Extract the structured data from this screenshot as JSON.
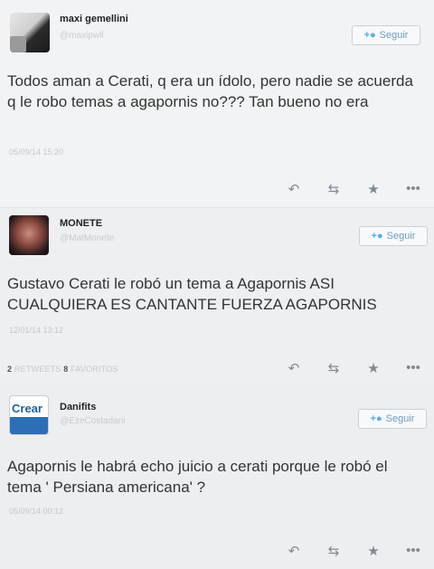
{
  "follow_label": "Seguir",
  "tweets": [
    {
      "name": "maxi gemellini",
      "handle": "@maxipwll",
      "text": "Todos aman a Cerati, q era un ídolo, pero nadie se acuerda q le robo temas a agapornis no??? Tan bueno no era",
      "timestamp": "05/09/14 15:20"
    },
    {
      "name": "MONETE",
      "handle": "@MatMonete",
      "text": "Gustavo Cerati le robó un tema a Agapornis ASI CUALQUIERA ES CANTANTE FUERZA AGAPORNIS",
      "timestamp": "12/01/14 13:12",
      "retweets_count": "2",
      "retweets_label": "RETWEETS",
      "favorites_count": "8",
      "favorites_label": "FAVORITOS"
    },
    {
      "name": "Danifits",
      "handle": "@EzeCostadani",
      "text": "Agapornis le habrá echo juicio a cerati porque le robó el tema ' Persiana americana' ?",
      "timestamp": "05/09/14 00:12",
      "avatar_text": "Crear"
    }
  ],
  "icons": {
    "reply": "reply-icon",
    "retweet": "retweet-icon",
    "favorite": "star-icon",
    "more": "more-icon",
    "follow": "follow-person-icon"
  },
  "colors": {
    "link_blue": "#55acee",
    "action_gray": "#7f8a94"
  }
}
